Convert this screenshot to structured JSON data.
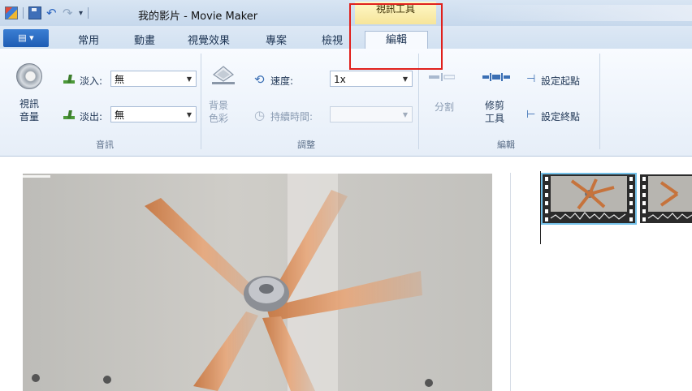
{
  "titlebar": {
    "title": "我的影片 - Movie Maker",
    "context_header": "視訊工具"
  },
  "tabs": {
    "file_label": "▤ ▾",
    "items": [
      "常用",
      "動畫",
      "視覺效果",
      "專案",
      "檢視"
    ],
    "active": "編輯"
  },
  "ribbon": {
    "audio": {
      "video_volume": "視訊\n音量",
      "fade_in_label": "淡入:",
      "fade_in_value": "無",
      "fade_out_label": "淡出:",
      "fade_out_value": "無",
      "group_label": "音訊"
    },
    "adjust": {
      "bg_color": "背景\n色彩",
      "speed_label": "速度:",
      "speed_value": "1x",
      "duration_label": "持續時間:",
      "duration_value": "",
      "group_label": "調整"
    },
    "edit": {
      "split": "分割",
      "trim": "修剪\n工具",
      "set_start": "設定起點",
      "set_end": "設定終點",
      "group_label": "編輯"
    }
  },
  "colors": {
    "highlight": "#e0201c",
    "context_tab": "#f6e59a",
    "file_button": "#1e5cb4",
    "clip_selected": "#73c0e8"
  }
}
